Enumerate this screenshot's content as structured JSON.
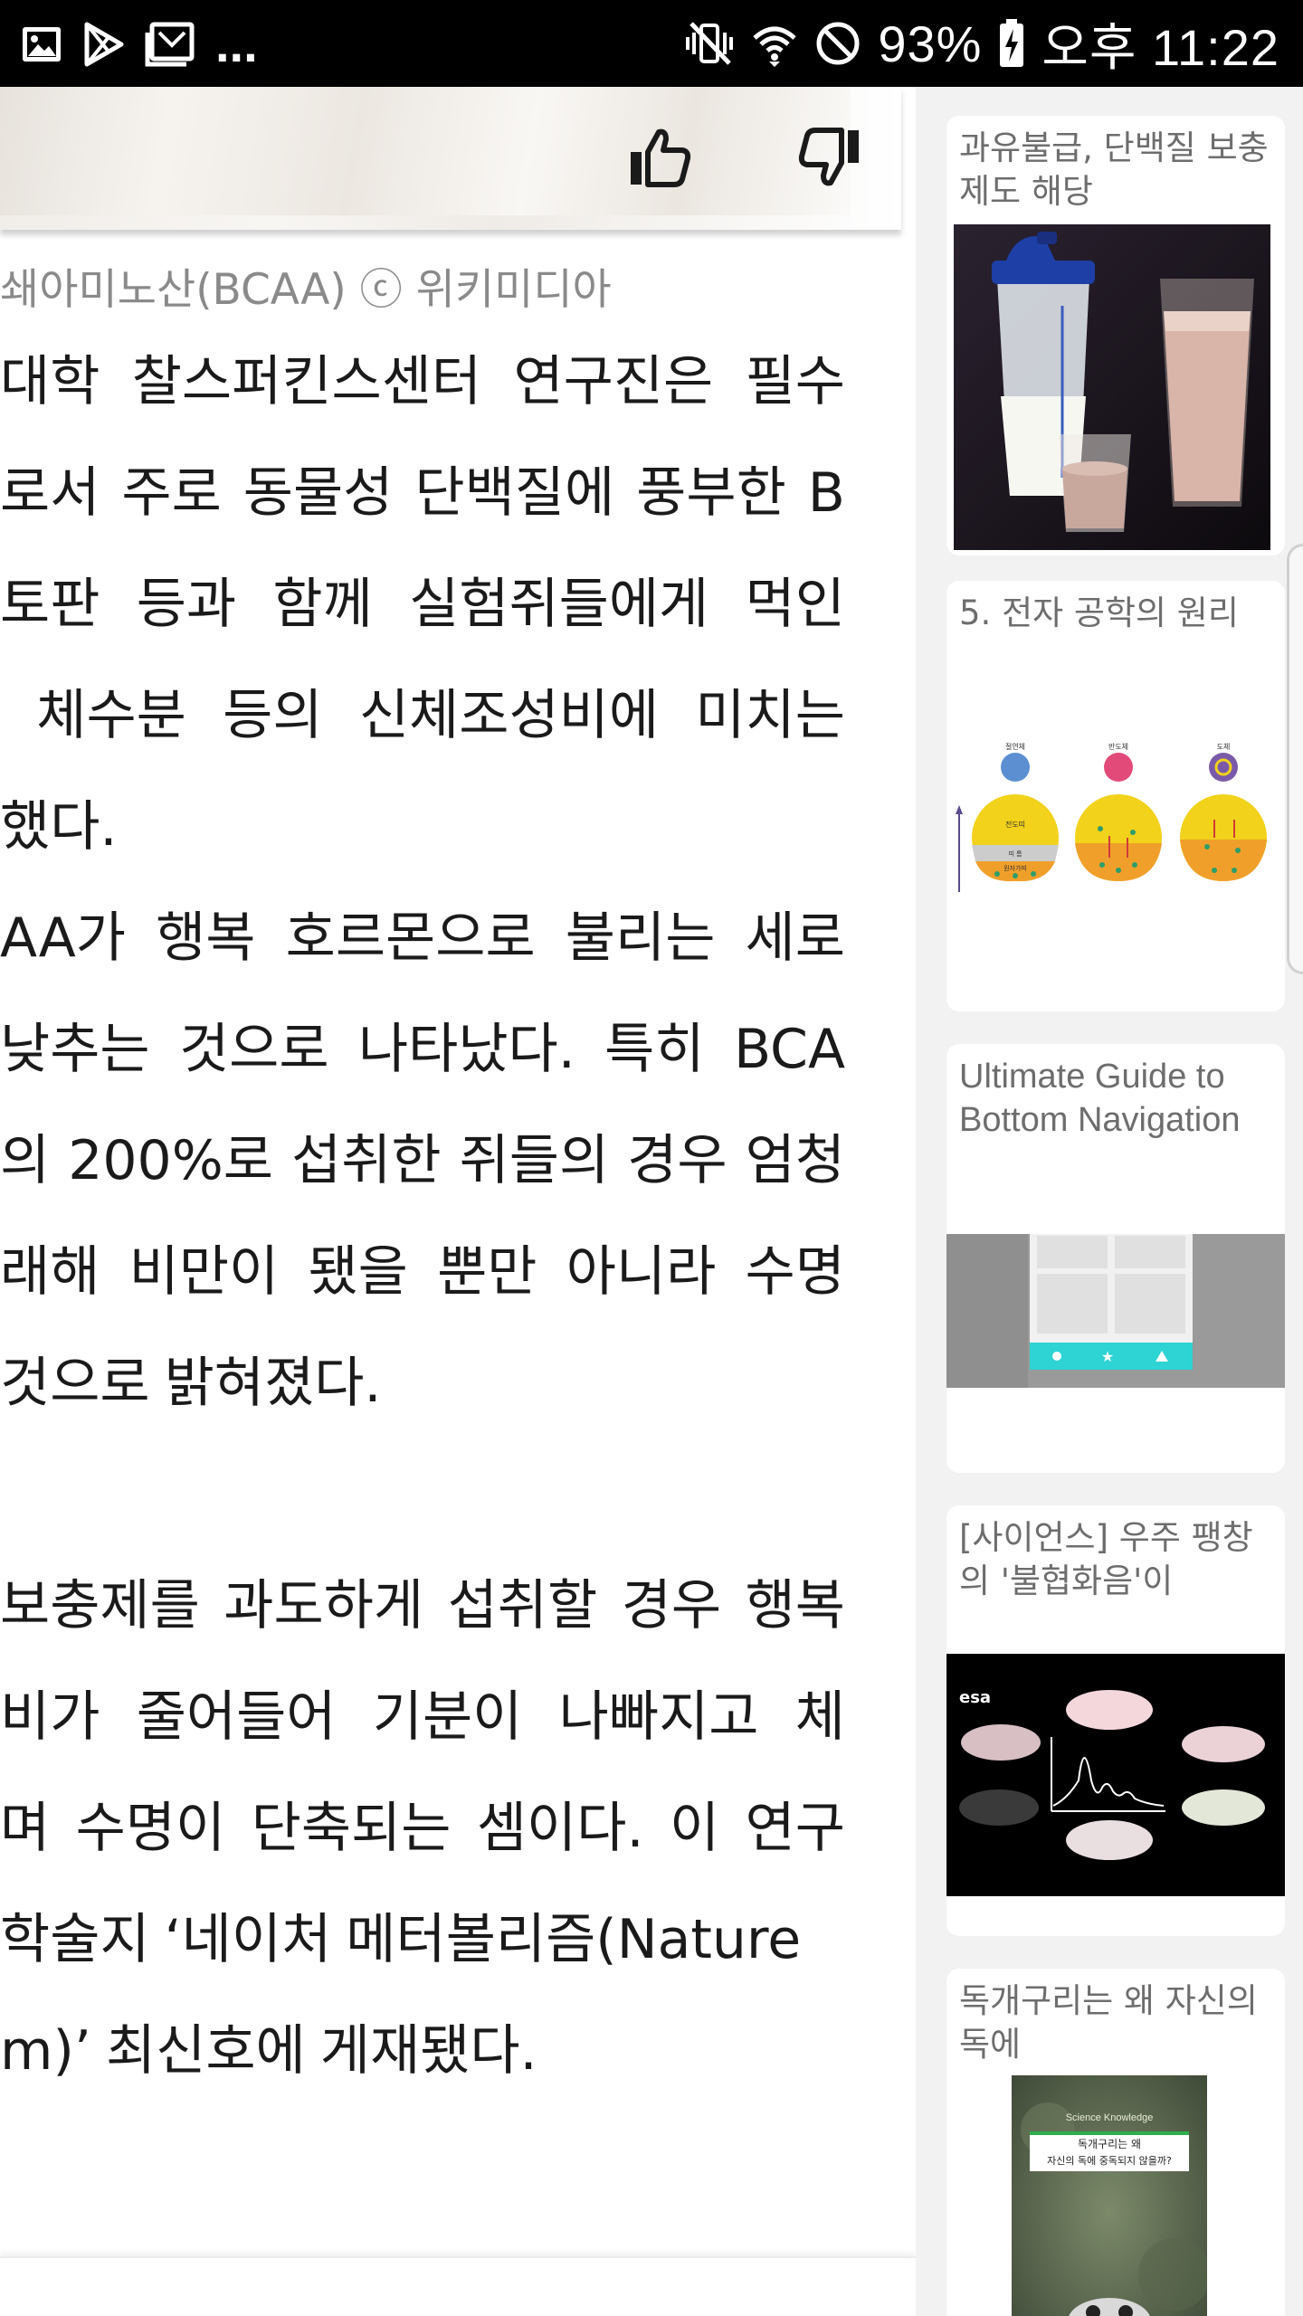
{
  "status_bar": {
    "battery_percent": "93%",
    "time": "오후 11:22",
    "overflow_dots": "..."
  },
  "article": {
    "image_caption": "쇄아미노산(BCAA) ⓒ 위키미디아",
    "paragraph_lines": [
      [
        "대학",
        "찰스퍼킨스센터",
        "연구진은",
        "필수"
      ],
      [
        "로서",
        "주로",
        "동물성",
        "단백질에",
        "풍부한",
        "B"
      ],
      [
        "토판",
        "등과",
        "함께",
        "실험쥐들에게",
        "먹인"
      ],
      [
        "",
        "체수분",
        "등의",
        "신체조성비에",
        "미치는"
      ],
      [
        "했다."
      ],
      [
        "AA가",
        "행복",
        "호르몬으로",
        "불리는",
        "세로"
      ],
      [
        "낮추는",
        "것으로",
        "나타났다.",
        "특히",
        "BCA"
      ],
      [
        "의",
        "200%로",
        "섭취한",
        "쥐들의",
        "경우",
        "엄청"
      ],
      [
        "래해",
        "비만이",
        "됐을",
        "뿐만",
        "아니라",
        "수명"
      ],
      [
        "것으로",
        "밝혀졌다."
      ],
      [],
      [
        "보충제를",
        "과도하게",
        "섭취할",
        "경우",
        "행복"
      ],
      [
        "비가",
        "줄어들어",
        "기분이",
        "나빠지고",
        "체"
      ],
      [
        "며",
        "수명이",
        "단축되는",
        "셈이다.",
        "이",
        "연구"
      ],
      [
        "학술지",
        "‘네이처",
        "메터볼리즘(Nature"
      ],
      [
        "m)’",
        "최신호에",
        "게재됐다."
      ]
    ]
  },
  "sidebar": {
    "cards": [
      {
        "title": "과유불급, 단백질 보충제도 해당",
        "image": "protein-shake-photo"
      },
      {
        "title": "5. 전자 공학의 원리",
        "image": "energy-band-diagram"
      },
      {
        "title": "Ultimate Guide to Bottom Navigation",
        "image": "bottom-navigation-mockup"
      },
      {
        "title": "[사이언스] 우주 팽창의 '불협화음'이",
        "image": "esa-cosmic-spectrum"
      },
      {
        "title": "독개구리는 왜 자신의 독에",
        "image": "poison-frog-book-cover"
      }
    ],
    "diagram_labels": [
      "절연체",
      "반도체",
      "도체",
      "전도띠",
      "띠 틈",
      "원자가띠"
    ],
    "book_cover": {
      "series": "Science Knowledge",
      "title_line_1": "독개구리는 왜",
      "title_line_2": "자신의 독에 중독되지 않을까?"
    },
    "esa_logo": "esa"
  },
  "colors": {
    "status_bar_bg": "#000000",
    "sidebar_bg": "#f2f2f2",
    "card_title": "#6d6d6d",
    "caption": "#8a8a8a",
    "nav_accent": "#2ed3d3"
  }
}
